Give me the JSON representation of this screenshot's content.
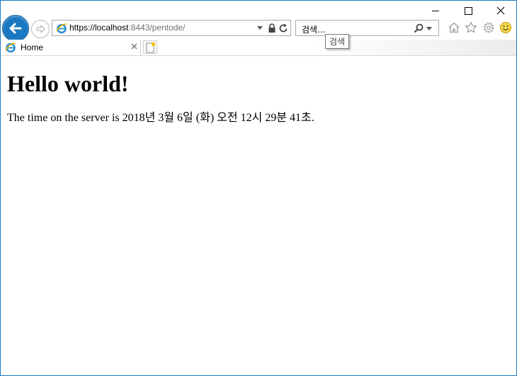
{
  "browser": {
    "address": {
      "url_main": "https://localhost",
      "url_rest": ":8443/pentode/"
    },
    "search": {
      "placeholder": "검색...",
      "tooltip": "검색"
    },
    "tabs": [
      {
        "label": "Home"
      }
    ]
  },
  "page": {
    "heading": "Hello world!",
    "paragraph": "The time on the server is 2018년 3월 6일 (화) 오전 12시 29분 41초."
  },
  "colors": {
    "window_border": "#1f7cc4",
    "back_button": "#1a78c2"
  },
  "icons": [
    "back-arrow-icon",
    "forward-arrow-icon",
    "ie-logo-icon",
    "lock-icon",
    "refresh-icon",
    "search-icon",
    "home-icon",
    "star-icon",
    "gear-icon",
    "smiley-icon",
    "close-icon",
    "new-tab-icon"
  ]
}
